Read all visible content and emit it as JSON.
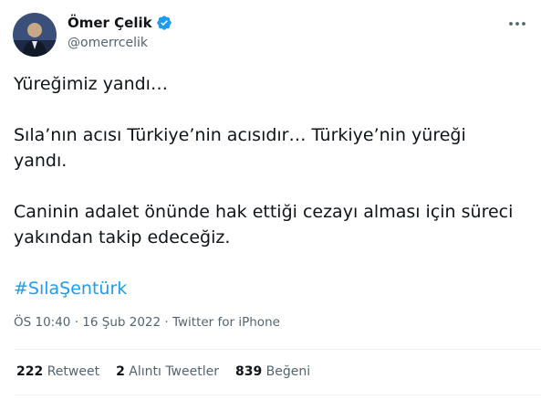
{
  "author": {
    "name": "Ömer Çelik",
    "handle": "@omerrcelik",
    "verified": true
  },
  "tweet": {
    "lines": [
      "Yüreğimiz yandı…",
      "Sıla’nın acısı Türkiye’nin acısıdır… Türkiye’nin yüreği yandı.",
      "Caninin adalet önünde hak ettiği cezayı alması için süreci yakından takip edeceğiz."
    ],
    "hashtag": "#SılaŞentürk"
  },
  "meta": {
    "time": "ÖS 10:40",
    "separator1": " · ",
    "date": "16 Şub 2022",
    "separator2": " · ",
    "source": "Twitter for iPhone"
  },
  "stats": {
    "retweets_count": "222",
    "retweets_label": "Retweet",
    "quotes_count": "2",
    "quotes_label": "Alıntı Tweetler",
    "likes_count": "839",
    "likes_label": "Beğeni"
  },
  "colors": {
    "link": "#1d9bf0",
    "secondary_text": "#536471",
    "primary_text": "#0f1419",
    "verified_badge": "#1d9bf0"
  },
  "icons": [
    "verified-badge-icon",
    "more-options-icon"
  ]
}
